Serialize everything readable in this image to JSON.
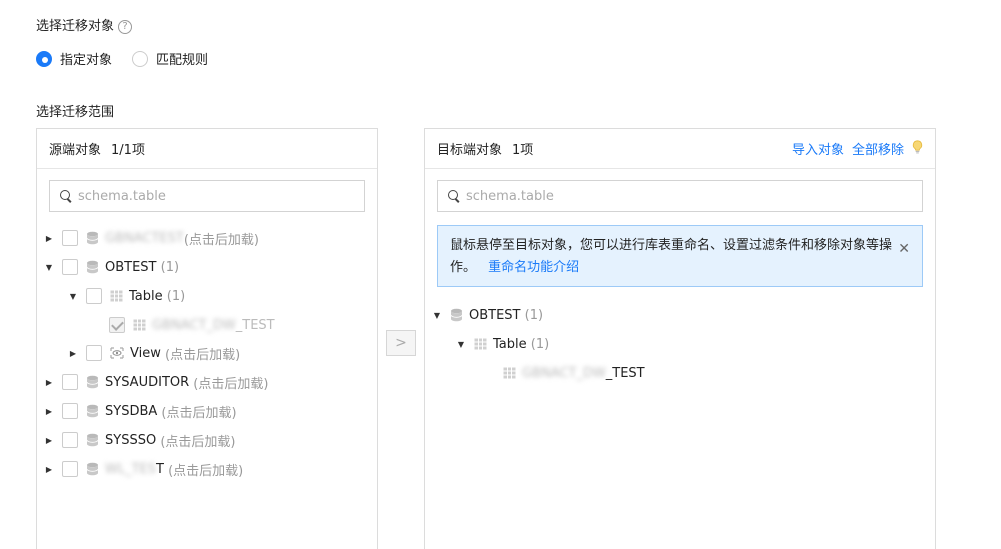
{
  "section1": {
    "title": "选择迁移对象"
  },
  "radios": [
    {
      "label": "指定对象",
      "selected": true
    },
    {
      "label": "匹配规则",
      "selected": false
    }
  ],
  "section2": {
    "title": "选择迁移范围"
  },
  "source": {
    "title": "源端对象",
    "count": "1/1项",
    "search_placeholder": "schema.table",
    "nodes": [
      {
        "name": "GBNACTEST",
        "suffix": "(点击后加载)"
      },
      {
        "name": "OBTEST",
        "suffix": "(1)"
      },
      {
        "name": "Table",
        "suffix": "(1)"
      },
      {
        "name_blur": "GBNACT_DW",
        "name_visible": "_TEST"
      },
      {
        "name": "View",
        "suffix": "(点击后加载)"
      },
      {
        "name": "SYSAUDITOR",
        "suffix": "(点击后加载)"
      },
      {
        "name": "SYSDBA",
        "suffix": "(点击后加载)"
      },
      {
        "name": "SYSSSO",
        "suffix": "(点击后加载)"
      },
      {
        "name_blur": "WL_TES",
        "name_visible": "T",
        "suffix": "(点击后加载)"
      }
    ]
  },
  "transfer_button": {
    "label": ">"
  },
  "target": {
    "title": "目标端对象",
    "count": "1项",
    "import_label": "导入对象",
    "remove_all_label": "全部移除",
    "search_placeholder": "schema.table",
    "notice_text": "鼠标悬停至目标对象，您可以进行库表重命名、设置过滤条件和移除对象等操作。",
    "notice_link": "重命名功能介绍",
    "nodes": [
      {
        "name": "OBTEST",
        "suffix": "(1)"
      },
      {
        "name": "Table",
        "suffix": "(1)"
      },
      {
        "name_blur": "GBNACT_DW",
        "name_visible": "_TEST"
      }
    ]
  },
  "colors": {
    "accent": "#1a7af8",
    "notice_bg": "#e5f2fe",
    "notice_border": "#9dcaf7"
  }
}
